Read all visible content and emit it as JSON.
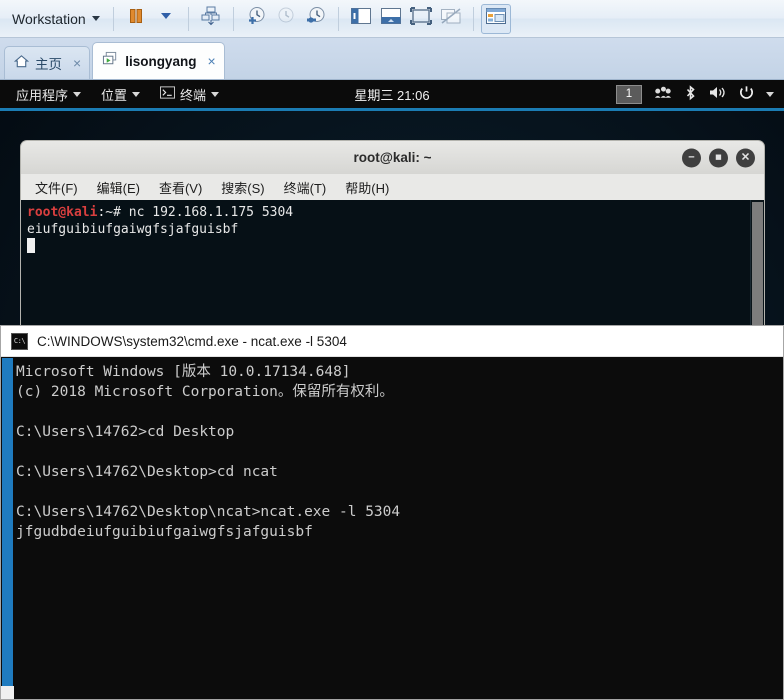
{
  "vmware": {
    "menu_label": "Workstation",
    "toolbar_icons": [
      "pause-icon",
      "power-dropdown-icon",
      "send-ctrl-alt-del-icon",
      "take-snapshot-icon",
      "revert-snapshot-icon",
      "manage-snapshots-icon",
      "show-sidebar-icon",
      "show-console-view-icon",
      "full-screen-icon",
      "unity-mode-icon",
      "show-thumbnail-bar-icon"
    ],
    "tabs": [
      {
        "label": "主页",
        "icon": "home-icon",
        "active": false,
        "close": "×"
      },
      {
        "label": "lisongyang",
        "icon": "vm-powered-on-icon",
        "active": true,
        "close": "×"
      }
    ]
  },
  "gnome_panel": {
    "applications": "应用程序",
    "places": "位置",
    "terminal": "终端",
    "terminal_icon": "terminal-icon",
    "clock": "星期三 21:06",
    "workspace": "1",
    "tray_icons": [
      "network-icon",
      "bluetooth-icon",
      "volume-icon",
      "power-icon"
    ],
    "tray_caret": "▾"
  },
  "terminal_window": {
    "title": "root@kali: ~",
    "window_buttons": {
      "minimize": "−",
      "maximize": "■",
      "close": "✕"
    },
    "menu": [
      "文件(F)",
      "编辑(E)",
      "查看(V)",
      "搜索(S)",
      "终端(T)",
      "帮助(H)"
    ],
    "prompt_user": "root@kali",
    "prompt_path": ":~# ",
    "command": "nc 192.168.1.175 5304",
    "output": "eiufguibiufgaiwgfsjafguisbf"
  },
  "cmd_window": {
    "title": "C:\\WINDOWS\\system32\\cmd.exe - ncat.exe  -l 5304",
    "icon": "cmd-icon",
    "lines": [
      "Microsoft Windows [版本 10.0.17134.648]",
      "(c) 2018 Microsoft Corporation。保留所有权利。",
      "",
      "C:\\Users\\14762>cd Desktop",
      "",
      "C:\\Users\\14762\\Desktop>cd ncat",
      "",
      "C:\\Users\\14762\\Desktop\\ncat>ncat.exe -l 5304",
      "jfgudbdeiufguibiufgaiwgfsjafguisbf"
    ]
  },
  "colors": {
    "accent_blue": "#1f7bbf",
    "kali_bg": "#081722",
    "cmd_bg": "#0c0c0c",
    "prompt_red": "#d93f3f"
  }
}
